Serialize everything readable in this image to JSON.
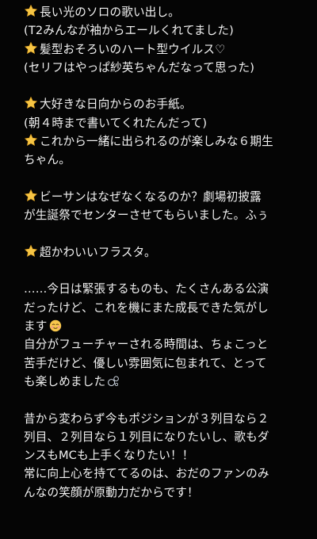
{
  "note": {
    "blocks": [
      [
        {
          "text": "長い光のソロの歌い出し。",
          "icon": "star-icon"
        },
        {
          "text": "(T2みんなが袖からエールくれてました)"
        },
        {
          "text": "髪型おそろいのハート型ウイルス♡",
          "icon": "star-icon"
        },
        {
          "text": "(セリフはやっぱ紗英ちゃんだなって思った)"
        }
      ],
      [
        {
          "text": "大好きな日向からのお手紙。",
          "icon": "star-icon"
        },
        {
          "text": "(朝４時まで書いてくれたんだって)"
        },
        {
          "text": "これから一緒に出られるのが楽しみな６期生",
          "icon": "star-icon"
        },
        {
          "text": "ちゃん。"
        }
      ],
      [
        {
          "text": "ビーサンはなぜなくなるのか？劇場初披露",
          "icon": "star-icon"
        },
        {
          "text": "が生誕祭でセンターさせてもらいました。ふぅ"
        }
      ],
      [
        {
          "text": "超かわいいフラスタ。",
          "icon": "star-icon"
        }
      ],
      [
        {
          "text": "……今日は緊張するものも、たくさんある公演"
        },
        {
          "text": "だったけど、これを機にまた成長できた気がし"
        },
        {
          "text": "ます",
          "trail": "relieved-face-emoji"
        },
        {
          "text": "自分がフューチャーされる時間は、ちょこっと"
        },
        {
          "text": "苦手だけど、優しい雰囲気に包まれて、とって"
        },
        {
          "text": "も楽しめました",
          "trail": "bubbles-emoji"
        }
      ],
      [
        {
          "text": "昔から変わらず今もポジションが３列目なら２"
        },
        {
          "text": "列目、２列目なら１列目になりたいし、歌もダ"
        },
        {
          "text": "ンスもMCも上手くなりたい！！"
        },
        {
          "text": "常に向上心を持ててるのは、おだのファンのみ"
        },
        {
          "text": "んなの笑顔が原動力だからです！"
        }
      ]
    ]
  },
  "colors": {
    "background": "#050505",
    "text": "#f2f2f2",
    "star": "#f6c545",
    "emoji_face": "#f7c64b"
  }
}
